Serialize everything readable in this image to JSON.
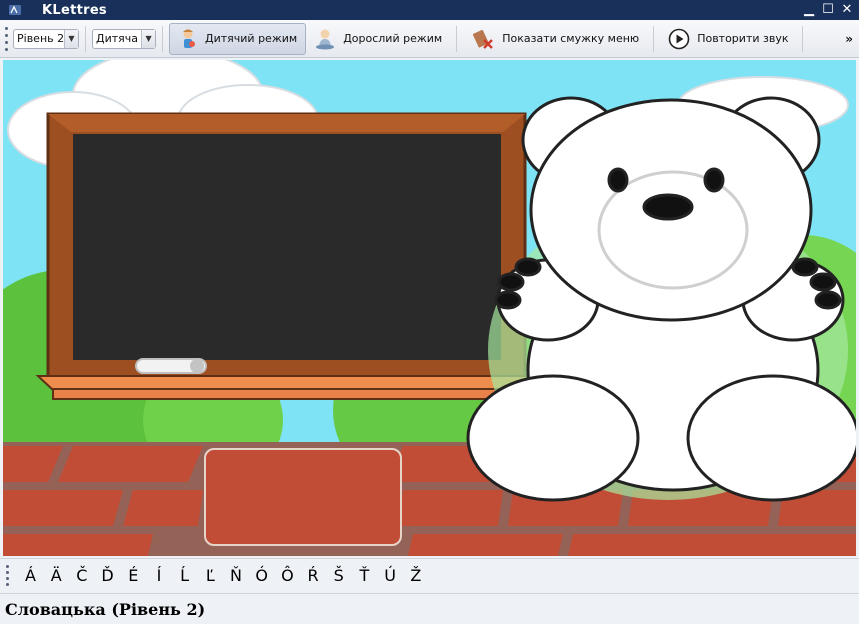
{
  "window": {
    "title": "KLettres",
    "controls": {
      "minimize": "▁",
      "maximize": "☐",
      "close": "✕"
    }
  },
  "toolbar": {
    "level_combo": {
      "value": "Рівень 2"
    },
    "language_combo": {
      "value": "Дитяча"
    },
    "buttons": [
      {
        "label": "Дитячий режим",
        "icon": "kid-mode-icon",
        "active": true
      },
      {
        "label": "Дорослий режим",
        "icon": "grownup-mode-icon",
        "active": false
      },
      {
        "label": "Показати смужку меню",
        "icon": "menubar-icon",
        "active": false
      },
      {
        "label": "Повторити звук",
        "icon": "play-icon",
        "active": false
      }
    ],
    "overflow": "»"
  },
  "letters": [
    "Á",
    "Ä",
    "Č",
    "Ď",
    "É",
    "Í",
    "Ĺ",
    "Ľ",
    "Ň",
    "Ó",
    "Ô",
    "Ŕ",
    "Š",
    "Ť",
    "Ú",
    "Ž"
  ],
  "status": {
    "text": "Словацька (Рівень 2)"
  },
  "colors": {
    "titlebar": "#18305a",
    "sky": "#7ee3f5",
    "blackboard": "#2a2a2a",
    "board_frame": "#a0522d",
    "brick": "#c24d37",
    "answer_border": "#e7d4c9"
  }
}
